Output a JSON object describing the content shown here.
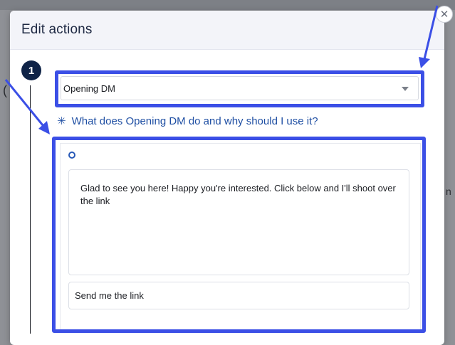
{
  "modal": {
    "title": "Edit actions",
    "close_symbol": "✕"
  },
  "step": {
    "number": "1"
  },
  "action_select": {
    "value": "Opening DM"
  },
  "help": {
    "icon": "sparkle-icon",
    "text": "What does Opening DM do and why should I use it?"
  },
  "message": {
    "text": "Glad to see you here! Happy you're interested. Click below and I'll shoot over the link",
    "button_label": "Send me the link"
  },
  "colors": {
    "highlight": "#3b4fe6",
    "badge": "#0f2347",
    "link": "#1f4fa3"
  }
}
